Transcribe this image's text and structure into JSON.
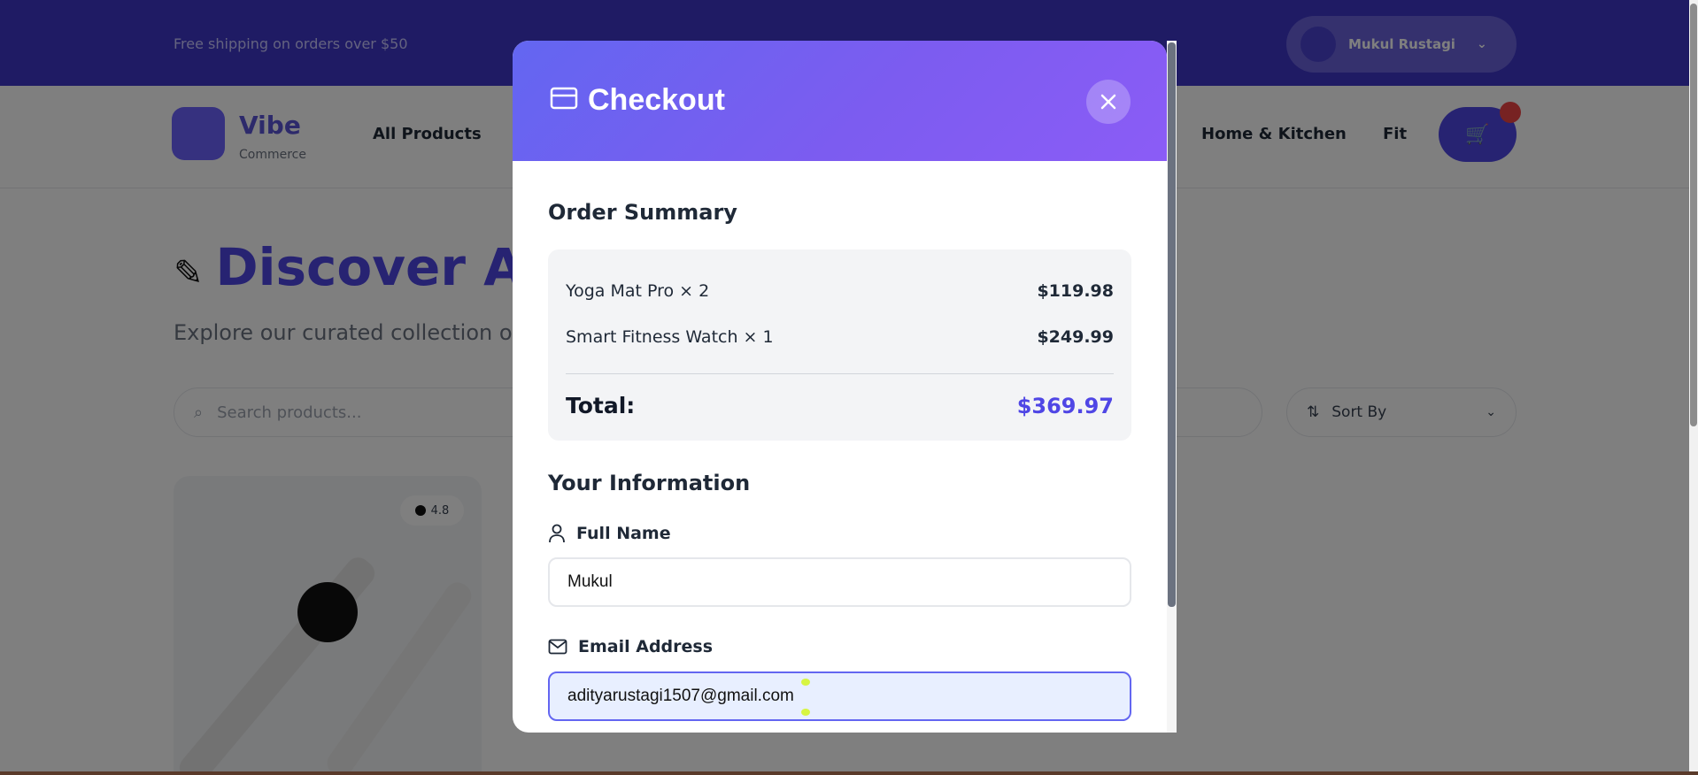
{
  "background": {
    "promo_text": "Free shipping on orders over $50",
    "user_name": "Mukul Rustagi",
    "brand_name": "Vibe",
    "brand_sub": "Commerce",
    "nav": [
      "All Products",
      "Home & Kitchen",
      "Fit"
    ],
    "hero_title": "Discover Ar",
    "hero_sub": "Explore our curated collection of pr",
    "search_placeholder": "Search products...",
    "sort_label": "Sort By",
    "product_badge": "4.8"
  },
  "modal": {
    "title": "Checkout",
    "order_summary_title": "Order Summary",
    "items": [
      {
        "name": "Yoga Mat Pro × 2",
        "price": "$119.98"
      },
      {
        "name": "Smart Fitness Watch × 1",
        "price": "$249.99"
      }
    ],
    "total_label": "Total:",
    "total_value": "$369.97",
    "info_title": "Your Information",
    "full_name_label": "Full Name",
    "full_name_value": "Mukul",
    "email_label": "Email Address",
    "email_value": "adityarustagi1507@gmail.com"
  },
  "colors": {
    "accent": "#6366f1",
    "accent_dark": "#4f46e5",
    "header_gradient_end": "#8b5cf6"
  },
  "icons": {
    "card": "credit-card-icon",
    "close": "close-icon",
    "user": "user-icon",
    "mail": "mail-icon"
  }
}
